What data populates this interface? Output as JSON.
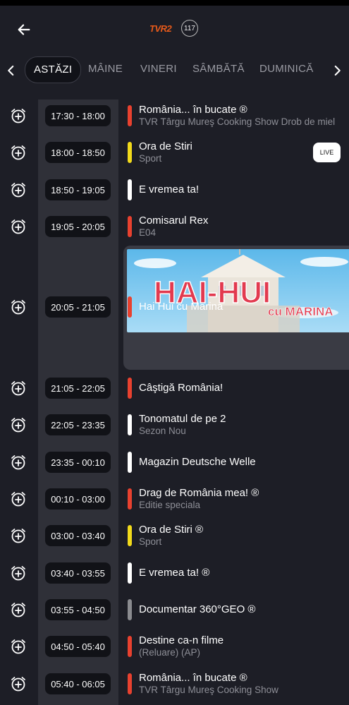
{
  "header": {
    "back_icon": "arrow-left-icon",
    "channel_logo": "TVR2",
    "channel_number": "117"
  },
  "days": {
    "items": [
      "ASTĂZI",
      "MÂINE",
      "VINERI",
      "SÂMBĂTĂ",
      "DUMINICĂ"
    ],
    "active_index": 0
  },
  "colors": {
    "red": "#e8412f",
    "yellow": "#f2da1b",
    "white": "#ffffff",
    "gray": "#8a8b8f",
    "background": "#1d1e26",
    "time_column": "#2f3038"
  },
  "program": [
    {
      "time": "17:30 - 18:00",
      "title": "România... în bucate ®",
      "subtitle": "TVR Târgu Mureş Cooking Show Drob de miel",
      "color": "red"
    },
    {
      "time": "18:00 - 18:50",
      "title": "Ora de Stiri",
      "subtitle": "Sport",
      "color": "yellow",
      "live": "LIVE"
    },
    {
      "time": "18:50 - 19:05",
      "title": "E vremea ta!",
      "subtitle": "",
      "color": "white"
    },
    {
      "time": "19:05 - 20:05",
      "title": "Comisarul Rex",
      "subtitle": "E04",
      "color": "red"
    },
    {
      "time": "20:05 - 21:05",
      "title": "Hai Hui cu Marina",
      "subtitle": "",
      "color": "red",
      "featured": true
    },
    {
      "time": "21:05 - 22:05",
      "title": "Câştigă România!",
      "subtitle": "",
      "color": "red"
    },
    {
      "time": "22:05 - 23:35",
      "title": "Tonomatul de pe 2",
      "subtitle": "Sezon Nou",
      "color": "white"
    },
    {
      "time": "23:35 - 00:10",
      "title": "Magazin Deutsche Welle",
      "subtitle": "",
      "color": "white"
    },
    {
      "time": "00:10 - 03:00",
      "title": "Drag de România mea! ®",
      "subtitle": "Editie speciala",
      "color": "red"
    },
    {
      "time": "03:00 - 03:40",
      "title": "Ora de Stiri ®",
      "subtitle": "Sport",
      "color": "yellow"
    },
    {
      "time": "03:40 - 03:55",
      "title": "E vremea ta! ®",
      "subtitle": "",
      "color": "white"
    },
    {
      "time": "03:55 - 04:50",
      "title": "Documentar 360°GEO ®",
      "subtitle": "",
      "color": "gray"
    },
    {
      "time": "04:50 - 05:40",
      "title": "Destine ca-n filme",
      "subtitle": "(Reluare) (AP)",
      "color": "red"
    },
    {
      "time": "05:40 - 06:05",
      "title": "România... în bucate ®",
      "subtitle": "TVR Târgu Mureş Cooking Show",
      "color": "red"
    }
  ],
  "featured_image": {
    "logo_text": "HAI-HUI",
    "logo_sub": "cu MARINA"
  }
}
